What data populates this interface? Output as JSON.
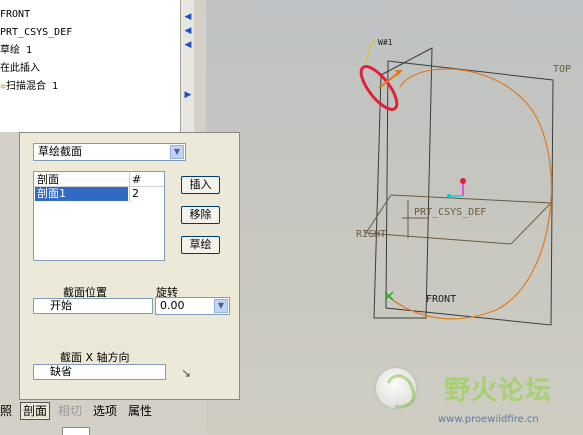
{
  "model_tree": {
    "items": [
      "FRONT",
      "PRT_CSYS_DEF",
      "草绘 1",
      "在此插入",
      "扫描混合 1"
    ]
  },
  "dashboard": {
    "section_type": "草绘截面",
    "list": {
      "col_section": "剖面",
      "col_count": "#",
      "rows": [
        {
          "name": "剖面1",
          "count": "2"
        }
      ]
    },
    "buttons": {
      "insert": "插入",
      "remove": "移除",
      "sketch": "草绘"
    },
    "section_location_label": "截面位置",
    "section_location_value": "开始",
    "rotation_label": "旋转",
    "rotation_value": "0.00",
    "x_axis_label": "截面 X 轴方向",
    "x_axis_value": "缺省"
  },
  "tabs": [
    "照",
    "剖面",
    "相切",
    "选项",
    "属性"
  ],
  "viewport": {
    "labels": {
      "top": "TOP",
      "right": "RIGHT",
      "front": "FRONT",
      "csys": "PRT_CSYS_DEF",
      "tag": "W#1"
    }
  },
  "watermark": {
    "title": "野火论坛",
    "url": "www.proewildfire.cn"
  },
  "colors": {
    "curve": "#e07b1c",
    "highlight": "#e0223a",
    "selection": "#316ac5",
    "plane": "#3c3c3c"
  }
}
